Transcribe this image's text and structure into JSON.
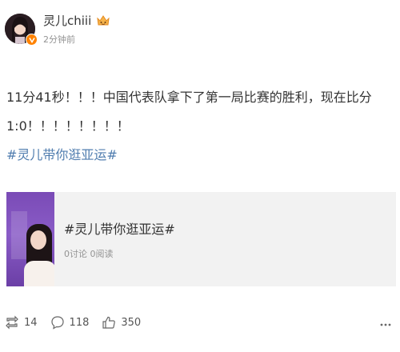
{
  "author": {
    "name": "灵儿chiii",
    "time": "2分钟前",
    "avatar_icon": "avatar-image",
    "verified_color": "#ff8200"
  },
  "post": {
    "line1": "11分41秒！！！中国代表队拿下了第一局比赛的胜利，现在比分",
    "line2": "1:0！！！！！！！！",
    "hashtag": "#灵儿带你逛亚运#"
  },
  "card": {
    "title": "#灵儿带你逛亚运#",
    "subtitle": "0讨论 0阅读"
  },
  "actions": {
    "repost_count": "14",
    "comment_count": "118",
    "like_count": "350"
  },
  "colors": {
    "link": "#507daf",
    "muted": "#939393"
  }
}
